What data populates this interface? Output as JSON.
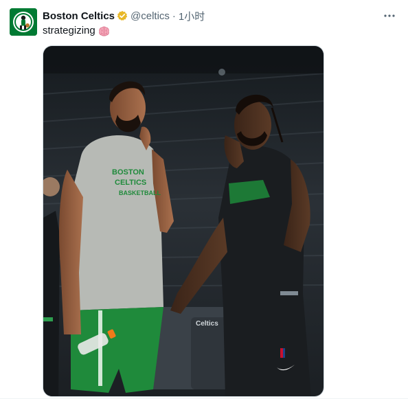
{
  "tweet": {
    "author_name": "Boston Celtics",
    "verified_badge": "gold-verified-badge-icon",
    "handle": "@celtics",
    "separator": "·",
    "time": "1小时",
    "text": "strategizing",
    "emoji": "brain-emoji-icon",
    "more_icon": "more-horizontal-icon",
    "avatar": "celtics-logo-icon",
    "media": {
      "shirt_left_text": [
        "BOSTON",
        "CELTICS",
        "BASKETBALL"
      ],
      "court_banner_text": "Celtics"
    }
  },
  "colors": {
    "celtics_green": "#007a33",
    "verified_gold": "#e8b829",
    "secondary_text": "#536471"
  }
}
